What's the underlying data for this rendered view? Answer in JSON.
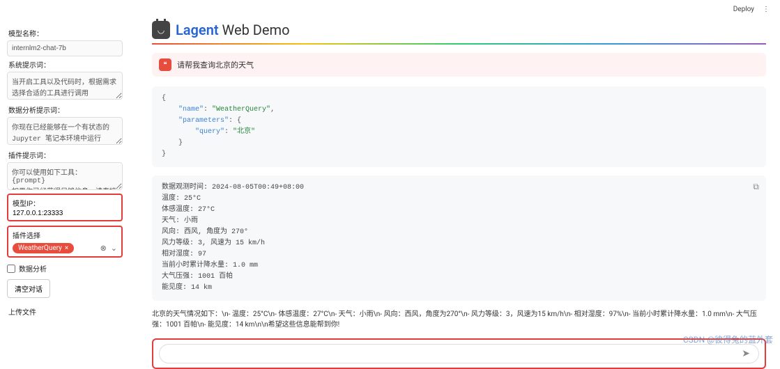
{
  "topbar": {
    "deploy": "Deploy"
  },
  "sidebar": {
    "model_label": "模型名称：",
    "model_value": "internlm2-chat-7b",
    "sys_label": "系统提示词：",
    "sys_value": "当开启工具以及代码时，根据需求选择合适的工具进行调用",
    "da_label": "数据分析提示词：",
    "da_value": "你现在已经能够在一个有状态的 Jupyter 笔记本环境中运行 Python 代码。当你向 python 发送含有 Python 代码的消息时，它将在该",
    "plugin_label": "插件提示词：",
    "plugin_value": "你可以使用如下工具：\n{prompt}\n如果你已经获得足够信息，请直接给出答案. 避免不必要的工具调用!",
    "ip_label": "模型IP：",
    "ip_value": "127.0.0.1:23333",
    "plugsel_label": "插件选择",
    "plugsel_tag": "WeatherQuery",
    "plugsel_x": "×",
    "da_check": "数据分析",
    "clear_btn": "清空对话",
    "upload_label": "上传文件"
  },
  "main": {
    "title_a": "Lagent",
    "title_b": " Web Demo",
    "user_msg": "请帮我查询北京的天气",
    "code": "{\n    \"name\": \"WeatherQuery\",\n    \"parameters\": {\n        \"query\": \"北京\"\n    }\n}",
    "res_lines": [
      "数据观测时间: 2024-08-05T00:49+08:00",
      "温度: 25°C",
      "体感温度: 27°C",
      "天气: 小雨",
      "风向: 西风, 角度为 270°",
      "风力等级: 3, 风速为 15 km/h",
      "相对湿度: 97",
      "当前小时累计降水量: 1.0 mm",
      "大气压强: 1001 百帕",
      "能见度: 14 km"
    ],
    "summary": "北京的天气情况如下：\\n- 温度：25°C\\n- 体感温度：27°C\\n- 天气：小雨\\n- 风向：西风，角度为270°\\n- 风力等级：3，风速为15 km/h\\n- 相对湿度：97%\\n- 当前小时累计降水量：1.0 mm\\n- 大气压强：1001 百帕\\n- 能见度：14 km\\n\\n希望这些信息能帮到你!",
    "chat_placeholder": ""
  },
  "watermark": "CSDN @彼得兔的蓝外套"
}
